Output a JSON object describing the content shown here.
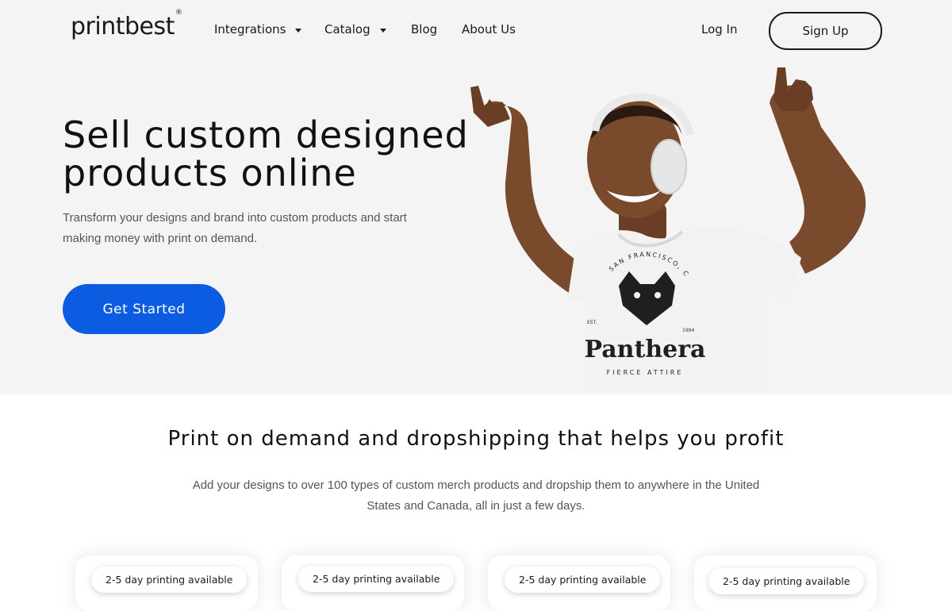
{
  "header": {
    "logo": "printbest",
    "logo_mark": "®",
    "nav": [
      {
        "label": "Integrations",
        "has_dropdown": true
      },
      {
        "label": "Catalog",
        "has_dropdown": true
      },
      {
        "label": "Blog",
        "has_dropdown": false
      },
      {
        "label": "About Us",
        "has_dropdown": false
      }
    ],
    "login_label": "Log In",
    "signup_label": "Sign Up"
  },
  "hero": {
    "title": "Sell custom designed products online",
    "subtitle": "Transform your designs and brand into custom products and start making money with print on demand.",
    "cta_label": "Get Started",
    "image": {
      "shirt_arc_text": "SAN FRANCISCO, CA",
      "shirt_brand": "Panthera",
      "shirt_tagline": "FIERCE ATTIRE",
      "shirt_left_year": "EST.",
      "shirt_right_year": "1994"
    }
  },
  "section": {
    "title": "Print on demand and dropshipping that helps you profit",
    "subtitle": "Add your designs to over 100 types of custom merch products and dropship them to anywhere in the United States and Canada, all in just a few days."
  },
  "cards": [
    {
      "badge": "2-5 day printing available"
    },
    {
      "badge": "2-5 day printing available"
    },
    {
      "badge": "2-5 day printing available"
    },
    {
      "badge": "2-5 day printing available"
    }
  ],
  "colors": {
    "accent": "#0b5ce0",
    "hero_background": "#f4f4f5",
    "text": "#111111",
    "muted_text": "#555555"
  }
}
